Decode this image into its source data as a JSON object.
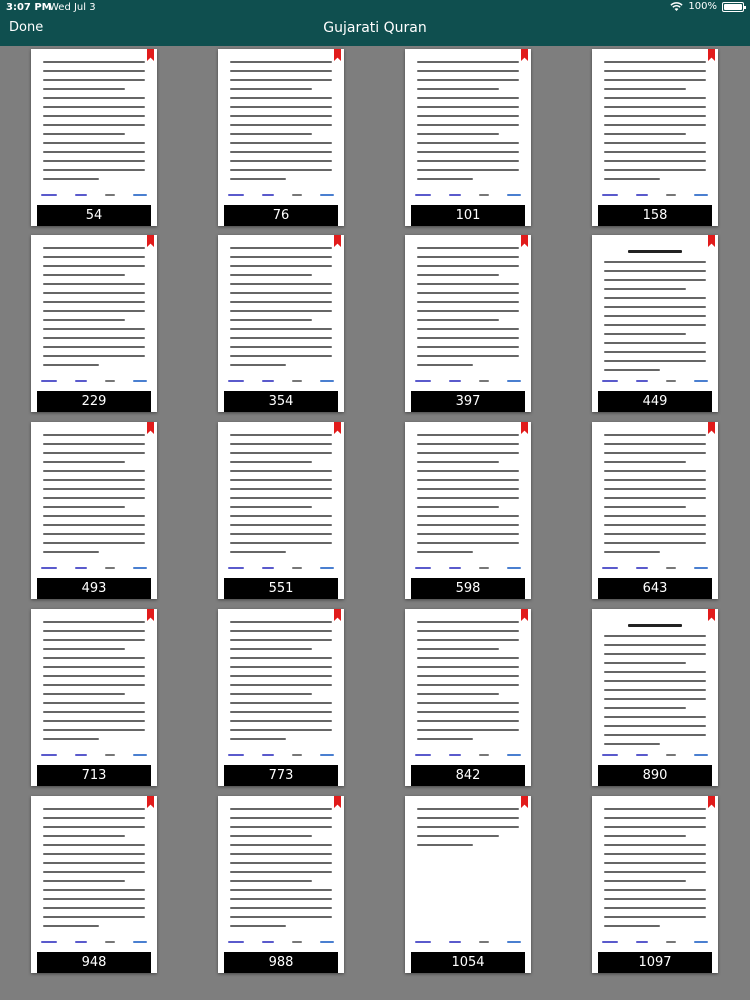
{
  "status_bar": {
    "time": "3:07 PM",
    "date": "Wed Jul 3",
    "battery": "100%"
  },
  "header": {
    "done_label": "Done",
    "title": "Gujarati Quran",
    "background_color": "#0f4f4f"
  },
  "colors": {
    "page_background": "#7e7e7e",
    "bookmark_ribbon": "#e11b1b",
    "page_number_bar": "#000000"
  },
  "pages": [
    "54",
    "76",
    "101",
    "158",
    "229",
    "354",
    "397",
    "449",
    "493",
    "551",
    "598",
    "643",
    "713",
    "773",
    "842",
    "890",
    "948",
    "988",
    "1054",
    "1097"
  ]
}
